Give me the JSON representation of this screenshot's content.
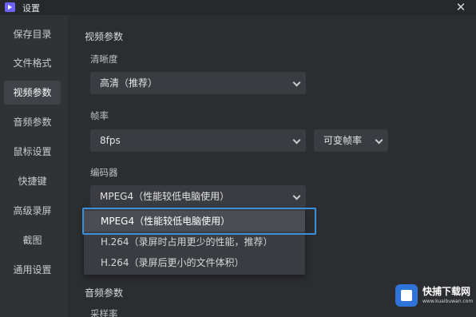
{
  "window": {
    "title": "设置",
    "close_glyph": "✕"
  },
  "sidebar": {
    "items": [
      {
        "label": "保存目录"
      },
      {
        "label": "文件格式"
      },
      {
        "label": "视频参数",
        "active": true
      },
      {
        "label": "音频参数"
      },
      {
        "label": "鼠标设置"
      },
      {
        "label": "快捷键"
      },
      {
        "label": "高级录屏"
      },
      {
        "label": "截图"
      },
      {
        "label": "通用设置"
      }
    ]
  },
  "video": {
    "section_title": "视频参数",
    "clarity": {
      "label": "清晰度",
      "value": "高清（推荐）"
    },
    "framerate": {
      "label": "帧率",
      "value": "8fps",
      "mode_value": "可变帧率"
    },
    "encoder": {
      "label": "编码器",
      "value": "MPEG4（性能较低电脑使用）",
      "options": [
        "MPEG4（性能较低电脑使用）",
        "H.264（录屏时占用更少的性能，推荐）",
        "H.264（录屏后更小的文件体积）"
      ]
    }
  },
  "audio": {
    "section_title": "音频参数",
    "sample_rate_label": "采样率"
  },
  "watermark": {
    "title": "快捕下载网",
    "subtitle": "www.kuaibuwan.com"
  },
  "colors": {
    "accent": "#3a8fd8",
    "background": "#2b2d31",
    "sidebar_active": "#3f4247"
  }
}
